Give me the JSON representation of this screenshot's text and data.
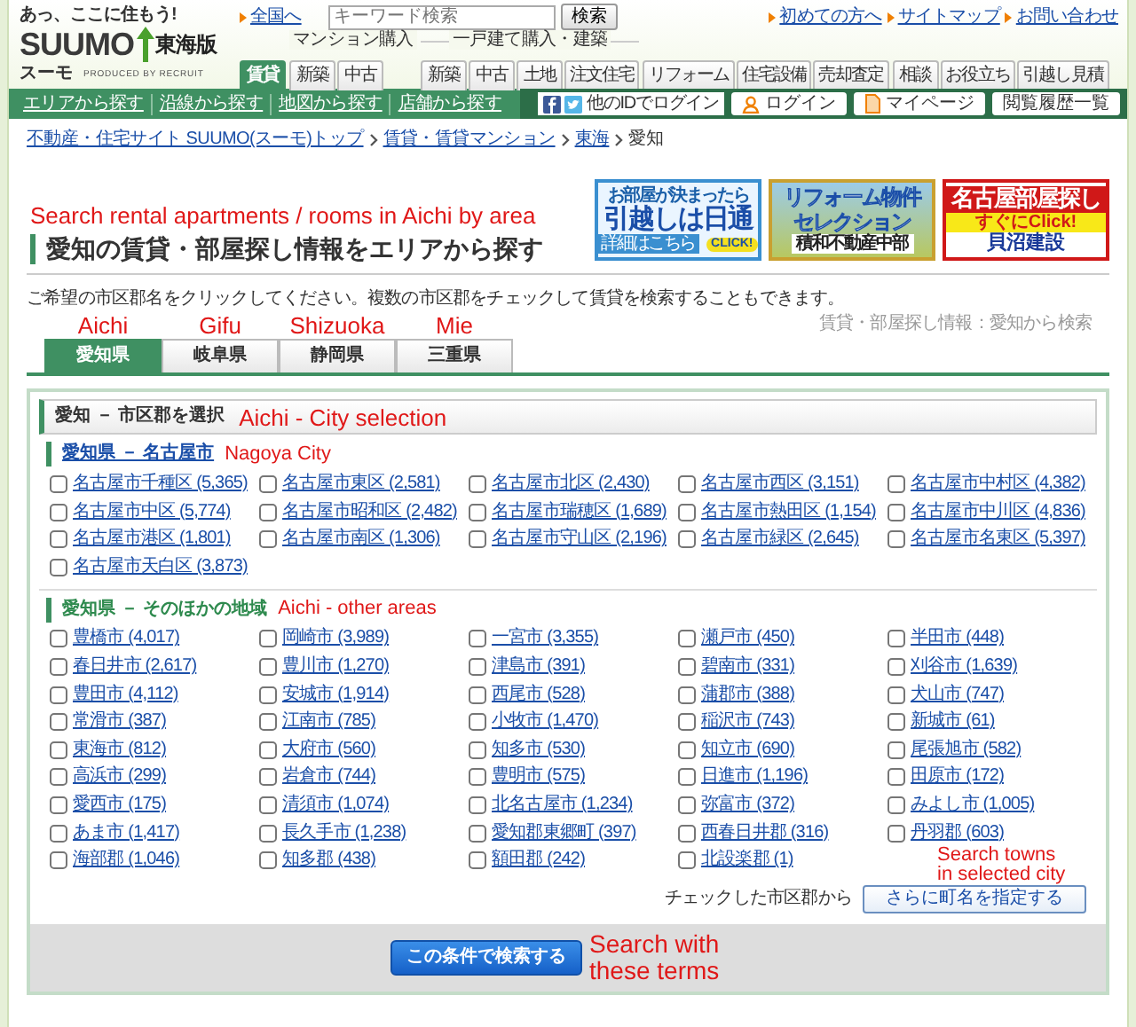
{
  "header": {
    "tagline": "あっ、ここに住もう!",
    "logo": "SUUMO",
    "edition": "東海版",
    "logo_sub": "スーモ",
    "produced_by": "PRODUCED BY RECRUIT",
    "national_link": "全国へ",
    "search": {
      "placeholder": "キーワード検索",
      "button": "検索"
    },
    "links": [
      "初めての方へ",
      "サイトマップ",
      "お問い合わせ"
    ],
    "nav": [
      {
        "tabs": [
          {
            "label": "賃貸",
            "selected": true
          }
        ]
      },
      {
        "label": "マンション購入",
        "tabs": [
          {
            "label": "新築",
            "selected": false
          },
          {
            "label": "中古",
            "selected": false
          }
        ]
      },
      {
        "label": "一戸建て購入・建築",
        "tabs": [
          {
            "label": "新築",
            "selected": false
          },
          {
            "label": "中古",
            "selected": false
          },
          {
            "label": "土地",
            "selected": false
          },
          {
            "label": "注文住宅",
            "selected": false
          }
        ]
      },
      {
        "tabs": [
          {
            "label": "リフォーム",
            "selected": false
          },
          {
            "label": "住宅設備",
            "selected": false
          },
          {
            "label": "売却査定",
            "selected": false
          }
        ]
      },
      {
        "tabs": [
          {
            "label": "相談",
            "selected": false
          },
          {
            "label": "お役立ち",
            "selected": false
          },
          {
            "label": "引越し見積",
            "selected": false
          }
        ]
      }
    ],
    "subnav": [
      "エリアから探す",
      "沿線から探す",
      "地図から探す",
      "店舗から探す"
    ],
    "social_login": "他のIDでログイン",
    "login": "ログイン",
    "mypage": "マイページ",
    "history": "閲覧履歴一覧"
  },
  "breadcrumb": [
    {
      "label": "不動産・住宅サイト SUUMO(スーモ)トップ",
      "link": true
    },
    {
      "label": "賃貸・賃貸マンション",
      "link": true
    },
    {
      "label": "東海",
      "link": true
    },
    {
      "label": "愛知",
      "link": false
    }
  ],
  "banners": [
    {
      "kind": "moving",
      "lines": [
        "お部屋が決まったら",
        "引越しは日通",
        "詳細はこちら",
        "CLICK!"
      ]
    },
    {
      "kind": "reform",
      "lines": [
        "リフォーム物件",
        "セレクション",
        "積和不動産中部"
      ]
    },
    {
      "kind": "rooms",
      "lines": [
        "名古屋部屋探し",
        "すぐにClick!",
        "貝沼建設"
      ]
    }
  ],
  "title_annotation": "Search rental apartments / rooms in Aichi by area",
  "title": "愛知の賃貸・部屋探し情報をエリアから探す",
  "description": "ご希望の市区郡名をクリックしてください。複数の市区郡をチェックして賃貸を検索することもできます。",
  "side_note": "賃貸・部屋探し情報：愛知から検索",
  "prefectures": [
    {
      "annotation": "Aichi",
      "label": "愛知県",
      "selected": true
    },
    {
      "annotation": "Gifu",
      "label": "岐阜県",
      "selected": false
    },
    {
      "annotation": "Shizuoka",
      "label": "静岡県",
      "selected": false
    },
    {
      "annotation": "Mie",
      "label": "三重県",
      "selected": false
    }
  ],
  "panel": {
    "title": "愛知 － 市区郡を選択",
    "annotation": "Aichi - City selection",
    "sections": [
      {
        "heading": "愛知県 － 名古屋市",
        "link": true,
        "annotation": "Nagoya City",
        "cities": [
          {
            "label": "名古屋市千種区 (5,365)",
            "checked": false
          },
          {
            "label": "名古屋市東区 (2,581)",
            "checked": false
          },
          {
            "label": "名古屋市北区 (2,430)",
            "checked": false
          },
          {
            "label": "名古屋市西区 (3,151)",
            "checked": false
          },
          {
            "label": "名古屋市中村区 (4,382)",
            "checked": false
          },
          {
            "label": "名古屋市中区 (5,774)",
            "checked": false
          },
          {
            "label": "名古屋市昭和区 (2,482)",
            "checked": false
          },
          {
            "label": "名古屋市瑞穂区 (1,689)",
            "checked": false
          },
          {
            "label": "名古屋市熱田区 (1,154)",
            "checked": false
          },
          {
            "label": "名古屋市中川区 (4,836)",
            "checked": false
          },
          {
            "label": "名古屋市港区 (1,801)",
            "checked": false
          },
          {
            "label": "名古屋市南区 (1,306)",
            "checked": false
          },
          {
            "label": "名古屋市守山区 (2,196)",
            "checked": false
          },
          {
            "label": "名古屋市緑区 (2,645)",
            "checked": false
          },
          {
            "label": "名古屋市名東区 (5,397)",
            "checked": false
          },
          {
            "label": "名古屋市天白区 (3,873)",
            "checked": false
          }
        ]
      },
      {
        "heading": "愛知県 － そのほかの地域",
        "link": false,
        "annotation": "Aichi - other areas",
        "cities": [
          {
            "label": "豊橋市 (4,017)",
            "checked": false
          },
          {
            "label": "岡崎市 (3,989)",
            "checked": false
          },
          {
            "label": "一宮市 (3,355)",
            "checked": false
          },
          {
            "label": "瀬戸市 (450)",
            "checked": false
          },
          {
            "label": "半田市 (448)",
            "checked": false
          },
          {
            "label": "春日井市 (2,617)",
            "checked": false
          },
          {
            "label": "豊川市 (1,270)",
            "checked": false
          },
          {
            "label": "津島市 (391)",
            "checked": false
          },
          {
            "label": "碧南市 (331)",
            "checked": false
          },
          {
            "label": "刈谷市 (1,639)",
            "checked": false
          },
          {
            "label": "豊田市 (4,112)",
            "checked": false
          },
          {
            "label": "安城市 (1,914)",
            "checked": false
          },
          {
            "label": "西尾市 (528)",
            "checked": false
          },
          {
            "label": "蒲郡市 (388)",
            "checked": false
          },
          {
            "label": "犬山市 (747)",
            "checked": false
          },
          {
            "label": "常滑市 (387)",
            "checked": false
          },
          {
            "label": "江南市 (785)",
            "checked": false
          },
          {
            "label": "小牧市 (1,470)",
            "checked": false
          },
          {
            "label": "稲沢市 (743)",
            "checked": false
          },
          {
            "label": "新城市 (61)",
            "checked": false
          },
          {
            "label": "東海市 (812)",
            "checked": false
          },
          {
            "label": "大府市 (560)",
            "checked": false
          },
          {
            "label": "知多市 (530)",
            "checked": false
          },
          {
            "label": "知立市 (690)",
            "checked": false
          },
          {
            "label": "尾張旭市 (582)",
            "checked": false
          },
          {
            "label": "高浜市 (299)",
            "checked": false
          },
          {
            "label": "岩倉市 (744)",
            "checked": false
          },
          {
            "label": "豊明市 (575)",
            "checked": false
          },
          {
            "label": "日進市 (1,196)",
            "checked": false
          },
          {
            "label": "田原市 (172)",
            "checked": false
          },
          {
            "label": "愛西市 (175)",
            "checked": false
          },
          {
            "label": "清須市 (1,074)",
            "checked": false
          },
          {
            "label": "北名古屋市 (1,234)",
            "checked": false
          },
          {
            "label": "弥富市 (372)",
            "checked": false
          },
          {
            "label": "みよし市 (1,005)",
            "checked": false
          },
          {
            "label": "あま市 (1,417)",
            "checked": false
          },
          {
            "label": "長久手市 (1,238)",
            "checked": false
          },
          {
            "label": "愛知郡東郷町 (397)",
            "checked": false
          },
          {
            "label": "西春日井郡 (316)",
            "checked": false
          },
          {
            "label": "丹羽郡 (603)",
            "checked": false
          },
          {
            "label": "海部郡 (1,046)",
            "checked": false
          },
          {
            "label": "知多郡 (438)",
            "checked": false
          },
          {
            "label": "額田郡 (242)",
            "checked": false
          },
          {
            "label": "北設楽郡 (1)",
            "checked": false
          }
        ]
      }
    ],
    "refine_label": "チェックした市区郡から",
    "refine_button": "さらに町名を指定する",
    "refine_annotation": "Search towns in selected city",
    "submit_button": "この条件で検索する",
    "submit_annotation": "Search with these terms"
  }
}
